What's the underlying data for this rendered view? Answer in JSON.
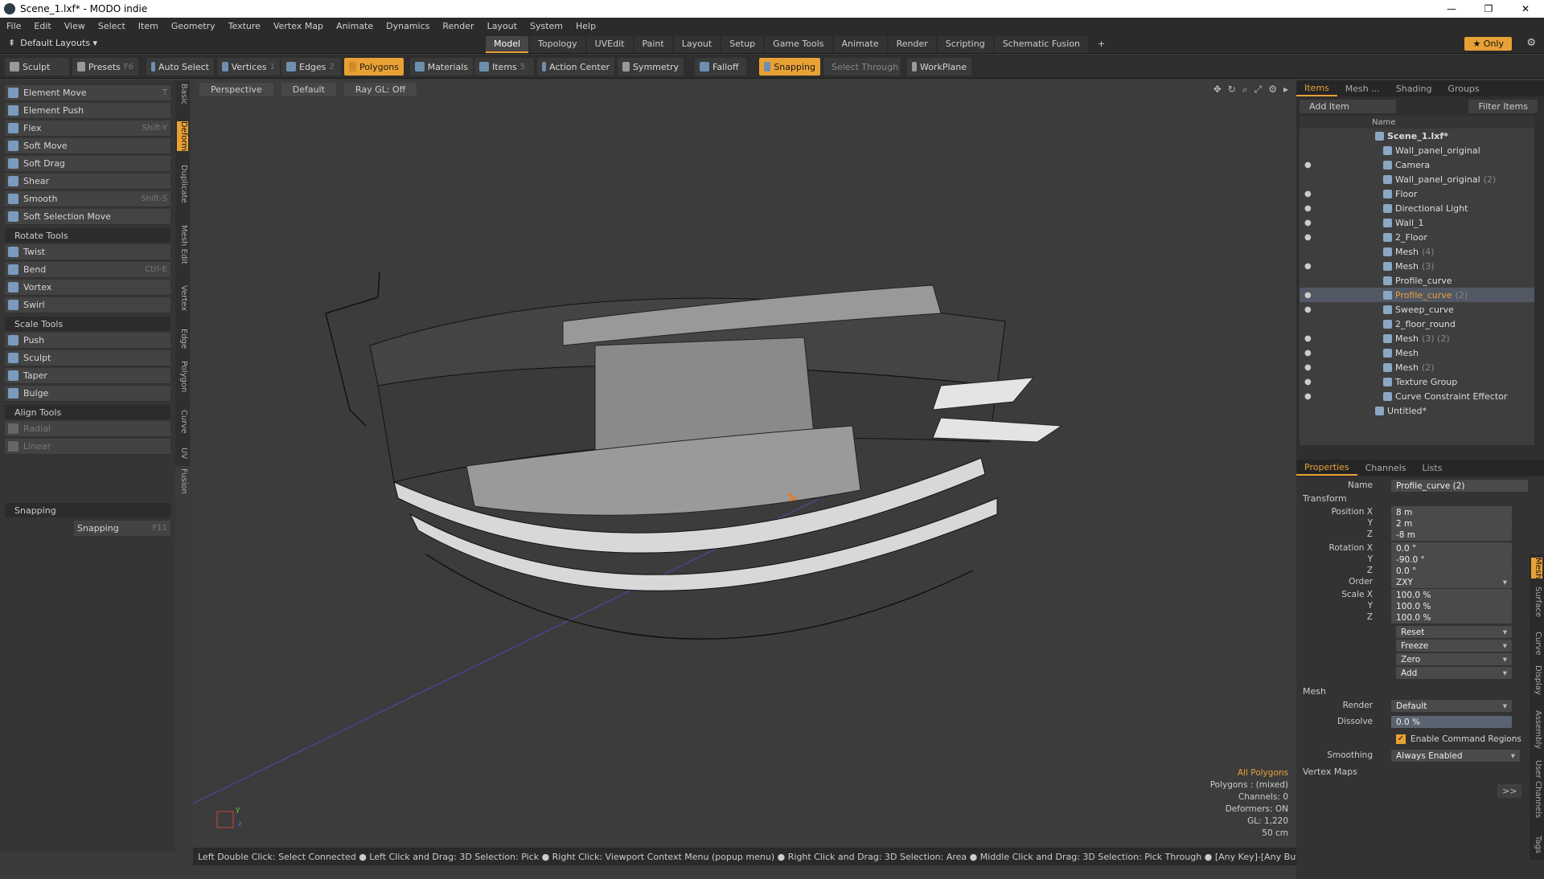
{
  "window": {
    "title": "Scene_1.lxf* - MODO indie",
    "min": "—",
    "max": "❐",
    "close": "✕"
  },
  "menu": [
    "File",
    "Edit",
    "View",
    "Select",
    "Item",
    "Geometry",
    "Texture",
    "Vertex Map",
    "Animate",
    "Dynamics",
    "Render",
    "Layout",
    "System",
    "Help"
  ],
  "layout": {
    "label": "Default Layouts ▾",
    "tabs": [
      "Model",
      "Topology",
      "UVEdit",
      "Paint",
      "Layout",
      "Setup",
      "Game Tools",
      "Animate",
      "Render",
      "Scripting",
      "Schematic Fusion"
    ],
    "add": "+",
    "only": "★ Only"
  },
  "toolbar": {
    "sculpt": "Sculpt",
    "presets": "Presets",
    "presets_key": "F6",
    "auto_select": "Auto Select",
    "vertices": "Vertices",
    "vertices_key": "1",
    "edges": "Edges",
    "edges_key": "2",
    "polygons": "Polygons",
    "materials": "Materials",
    "items": "Items",
    "items_key": "5",
    "action_center": "Action Center",
    "symmetry": "Symmetry",
    "falloff": "Falloff",
    "snapping": "Snapping",
    "select_through": "Select Through",
    "workplane": "WorkPlane"
  },
  "left": {
    "deform_tools": [
      {
        "label": "Element Move",
        "key": "T"
      },
      {
        "label": "Element Push",
        "key": ""
      },
      {
        "label": "Flex",
        "key": "Shift-Y"
      },
      {
        "label": "Soft Move",
        "key": ""
      },
      {
        "label": "Soft Drag",
        "key": ""
      },
      {
        "label": "Shear",
        "key": ""
      },
      {
        "label": "Smooth",
        "key": "Shift-S"
      },
      {
        "label": "Soft Selection Move",
        "key": ""
      }
    ],
    "rotate_header": "Rotate Tools",
    "rotate_tools": [
      {
        "label": "Twist",
        "key": ""
      },
      {
        "label": "Bend",
        "key": "Ctrl-E"
      },
      {
        "label": "Vortex",
        "key": ""
      },
      {
        "label": "Swirl",
        "key": ""
      }
    ],
    "scale_header": "Scale Tools",
    "scale_tools": [
      {
        "label": "Push",
        "key": ""
      },
      {
        "label": "Sculpt",
        "key": ""
      },
      {
        "label": "Taper",
        "key": ""
      },
      {
        "label": "Bulge",
        "key": ""
      }
    ],
    "align_header": "Align Tools",
    "align_tools": [
      {
        "label": "Radial",
        "key": ""
      },
      {
        "label": "Linear",
        "key": ""
      }
    ],
    "snapping_header": "Snapping",
    "snapping_btn": "Snapping",
    "snapping_key": "F11",
    "vtabs": [
      "Basic",
      "Deform",
      "Duplicate",
      "Mesh Edit",
      "Vertex",
      "Edge",
      "Polygon",
      "Curve",
      "UV",
      "Fusion"
    ]
  },
  "viewport": {
    "perspective": "Perspective",
    "default": "Default",
    "raygl": "Ray GL: Off",
    "info": {
      "all": "All Polygons",
      "polys": "Polygons : (mixed)",
      "channels": "Channels: 0",
      "deformers": "Deformers: ON",
      "gl": "GL: 1,220",
      "scale": "50 cm"
    }
  },
  "status": "Left Double Click: Select Connected ● Left Click and Drag: 3D Selection: Pick ● Right Click: Viewport Context Menu (popup menu) ● Right Click and Drag: 3D Selection: Area ● Middle Click and Drag: 3D Selection: Pick Through ● [Any Key]-[Any Button] Click and Drag: dragDropB ...",
  "right": {
    "tabs": [
      "Items",
      "Mesh ...",
      "Shading",
      "Groups"
    ],
    "add_item": "Add Item",
    "filter_items": "Filter Items",
    "name_col": "Name",
    "tree": [
      {
        "label": "Scene_1.lxf*",
        "dim": "",
        "indent": 0,
        "eye": false,
        "sel": false,
        "bold": true
      },
      {
        "label": "Wall_panel_original",
        "dim": "",
        "indent": 1,
        "eye": false,
        "sel": false
      },
      {
        "label": "Camera",
        "dim": "",
        "indent": 1,
        "eye": true,
        "sel": false
      },
      {
        "label": "Wall_panel_original",
        "dim": "(2)",
        "indent": 1,
        "eye": false,
        "sel": false
      },
      {
        "label": "Floor",
        "dim": "",
        "indent": 1,
        "eye": true,
        "sel": false
      },
      {
        "label": "Directional Light",
        "dim": "",
        "indent": 1,
        "eye": true,
        "sel": false
      },
      {
        "label": "Wall_1",
        "dim": "",
        "indent": 1,
        "eye": true,
        "sel": false
      },
      {
        "label": "2_Floor",
        "dim": "",
        "indent": 1,
        "eye": true,
        "sel": false
      },
      {
        "label": "Mesh",
        "dim": "(4)",
        "indent": 1,
        "eye": false,
        "sel": false
      },
      {
        "label": "Mesh",
        "dim": "(3)",
        "indent": 1,
        "eye": true,
        "sel": false
      },
      {
        "label": "Profile_curve",
        "dim": "",
        "indent": 1,
        "eye": false,
        "sel": false
      },
      {
        "label": "Profile_curve",
        "dim": "(2)",
        "indent": 1,
        "eye": true,
        "sel": true
      },
      {
        "label": "Sweep_curve",
        "dim": "",
        "indent": 1,
        "eye": true,
        "sel": false
      },
      {
        "label": "2_floor_round",
        "dim": "",
        "indent": 1,
        "eye": false,
        "sel": false
      },
      {
        "label": "Mesh",
        "dim": "(3) (2)",
        "indent": 1,
        "eye": true,
        "sel": false
      },
      {
        "label": "Mesh",
        "dim": "",
        "indent": 1,
        "eye": true,
        "sel": false
      },
      {
        "label": "Mesh",
        "dim": "(2)",
        "indent": 1,
        "eye": true,
        "sel": false
      },
      {
        "label": "Texture Group",
        "dim": "",
        "indent": 1,
        "eye": true,
        "sel": false
      },
      {
        "label": "Curve Constraint Effector",
        "dim": "",
        "indent": 1,
        "eye": true,
        "sel": false
      },
      {
        "label": "Untitled*",
        "dim": "",
        "indent": 0,
        "eye": false,
        "sel": false
      }
    ],
    "ptabs": [
      "Properties",
      "Channels",
      "Lists"
    ],
    "name_label": "Name",
    "name_value": "Profile_curve (2)",
    "transform": "Transform",
    "position_label": "Position X",
    "pos": [
      "8 m",
      "2 m",
      "-8 m"
    ],
    "rotation_label": "Rotation X",
    "rot": [
      "0.0 °",
      "-90.0 °",
      "0.0 °"
    ],
    "order_label": "Order",
    "order": "ZXY",
    "scale_label": "Scale X",
    "scale": [
      "100.0 %",
      "100.0 %",
      "100.0 %"
    ],
    "y": "Y",
    "z": "Z",
    "actions": [
      "Reset",
      "Freeze",
      "Zero",
      "Add"
    ],
    "mesh": "Mesh",
    "render_label": "Render",
    "render": "Default",
    "dissolve_label": "Dissolve",
    "dissolve": "0.0 %",
    "ecr": "Enable Command Regions",
    "smoothing_label": "Smoothing",
    "smoothing": "Always Enabled",
    "vertex_maps": "Vertex Maps",
    "more": ">>",
    "rvtabs": [
      "Mesh",
      "Surface",
      "Curve",
      "Display",
      "Assembly",
      "User Channels",
      "Tags"
    ]
  }
}
